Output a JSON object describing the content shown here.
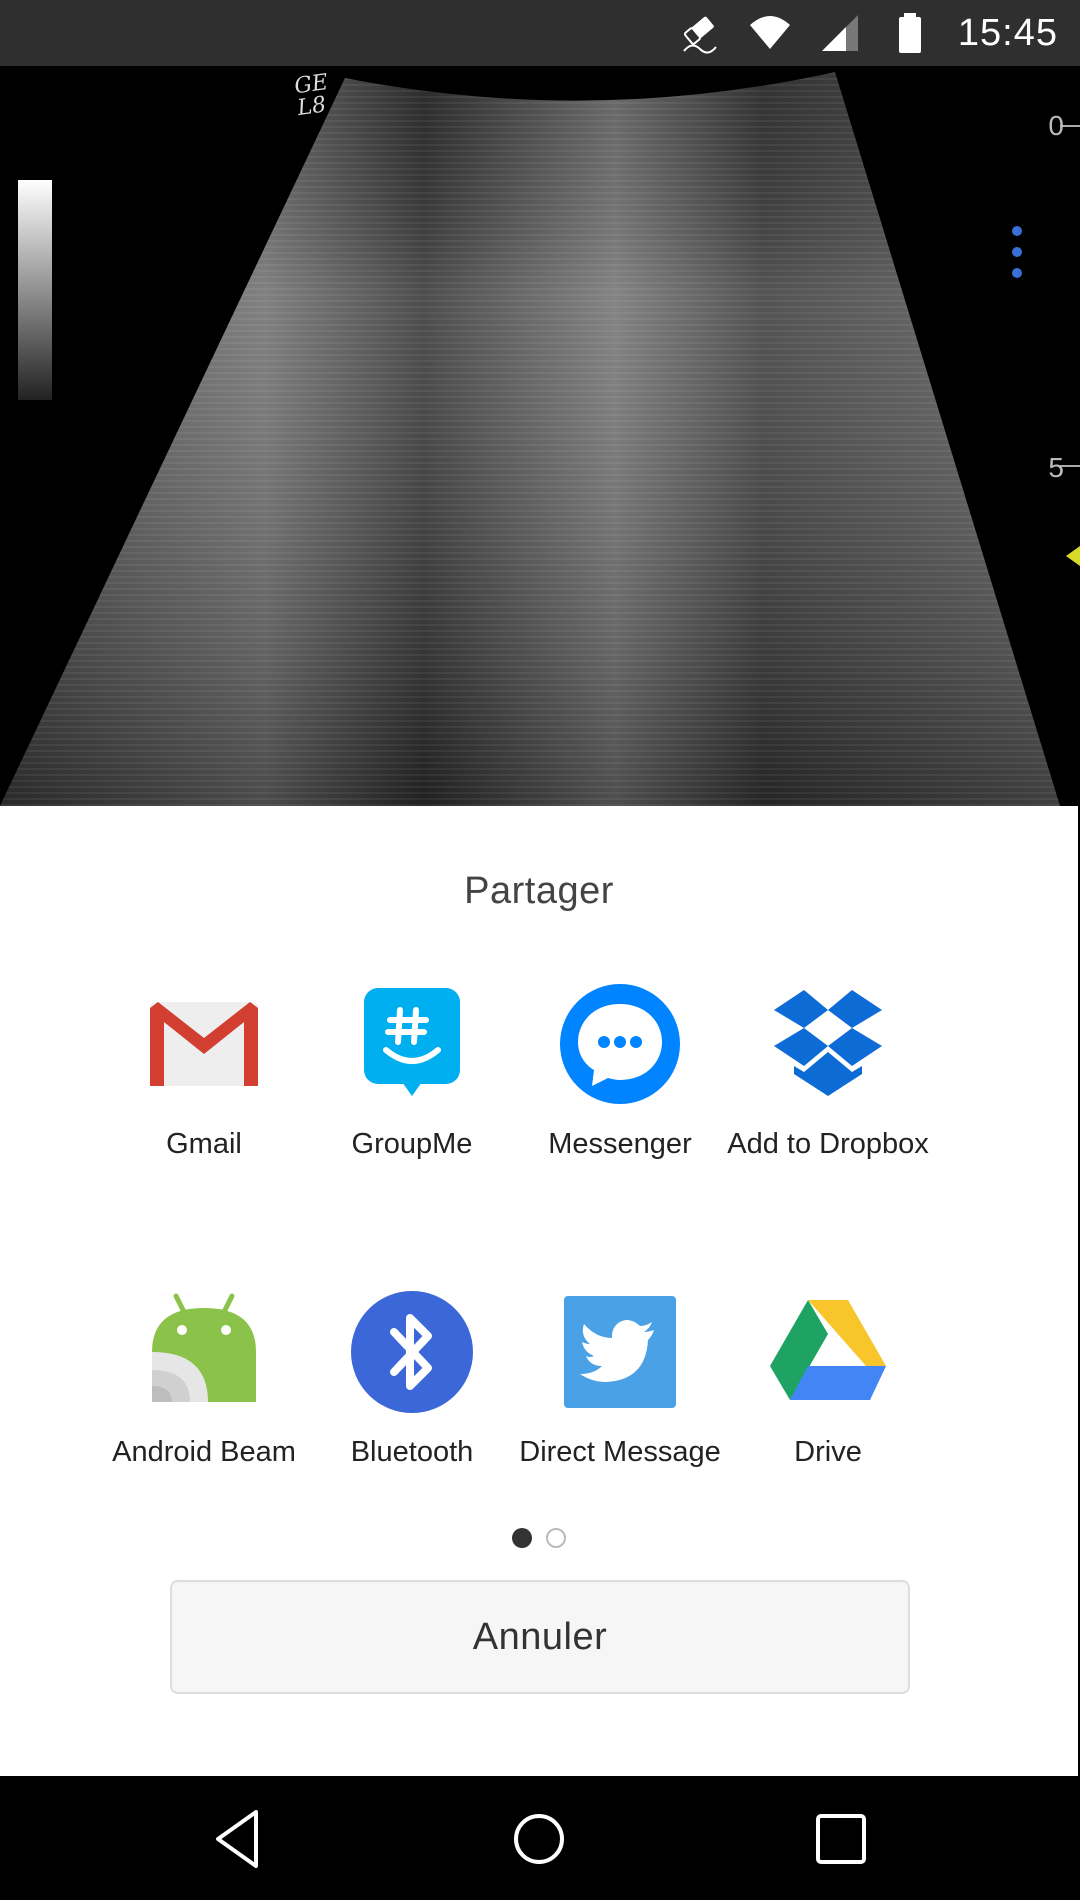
{
  "status_bar": {
    "time": "15:45",
    "icons": [
      "eraser-notification-icon",
      "wifi-icon",
      "cell-signal-icon",
      "battery-icon"
    ]
  },
  "image_view": {
    "logo_text": "GE",
    "logo_subtext": "L8",
    "scale_labels": [
      "0",
      "5"
    ]
  },
  "share_sheet": {
    "title": "Partager",
    "apps": [
      {
        "label": "Gmail",
        "icon": "gmail-icon"
      },
      {
        "label": "GroupMe",
        "icon": "groupme-icon"
      },
      {
        "label": "Messenger",
        "icon": "messenger-icon"
      },
      {
        "label": "Add to Dropbox",
        "icon": "dropbox-icon"
      },
      {
        "label": "Android Beam",
        "icon": "android-beam-icon"
      },
      {
        "label": "Bluetooth",
        "icon": "bluetooth-icon"
      },
      {
        "label": "Direct Message",
        "icon": "twitter-icon"
      },
      {
        "label": "Drive",
        "icon": "google-drive-icon"
      }
    ],
    "page_indicator": {
      "current": 1,
      "total": 2
    },
    "cancel_label": "Annuler"
  },
  "colors": {
    "status_bar_bg": "#2f2f2f",
    "sheet_bg": "#ffffff",
    "gmail_red": "#d23f31",
    "groupme_blue": "#00aff0",
    "messenger_blue": "#0084ff",
    "dropbox_blue": "#0d6bd6",
    "android_green": "#8bc34a",
    "bluetooth_blue": "#3b67d8",
    "twitter_blue": "#4aa1e6"
  },
  "nav_bar": {
    "buttons": [
      "back-icon",
      "home-icon",
      "recents-icon"
    ]
  }
}
